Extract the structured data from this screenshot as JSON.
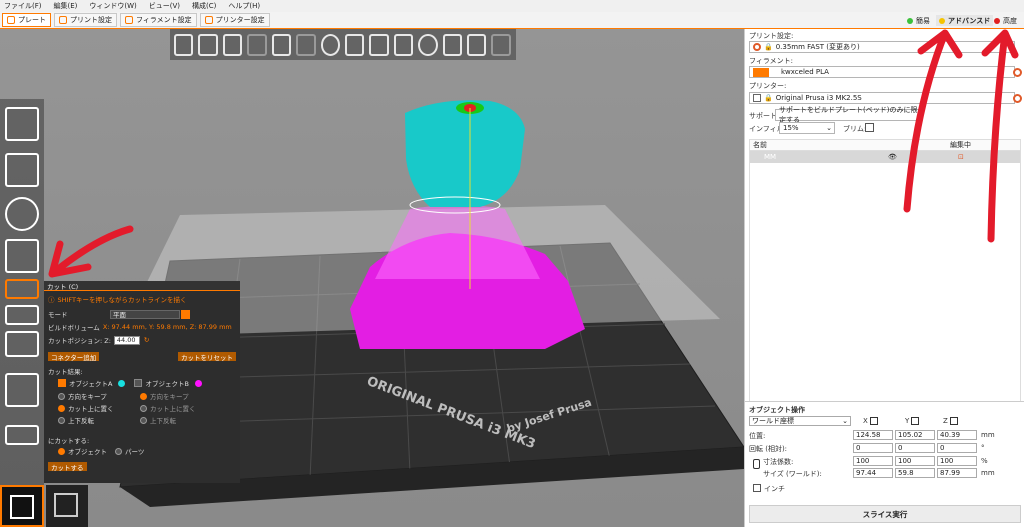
{
  "menu": [
    "ファイル(F)",
    "編集(E)",
    "ウィンドウ(W)",
    "ビュー(V)",
    "構成(C)",
    "ヘルプ(H)"
  ],
  "tabs": [
    {
      "label": "プレート",
      "active": true
    },
    {
      "label": "プリント設定",
      "active": false
    },
    {
      "label": "フィラメント設定",
      "active": false
    },
    {
      "label": "プリンター設定",
      "active": false
    }
  ],
  "modes": [
    {
      "label": "簡易",
      "color": "#3cc13c"
    },
    {
      "label": "アドバンスド",
      "color": "#f5c400",
      "active": true
    },
    {
      "label": "高度",
      "color": "#e02020"
    }
  ],
  "right": {
    "print_settings_label": "プリント設定:",
    "print_settings_value": "0.35mm FAST (変更あり)",
    "filament_label": "フィラメント:",
    "filament_value": "kwxceled PLA",
    "filament_color": "#ff7a00",
    "printer_label": "プリンター:",
    "printer_value": "Original Prusa i3 MK2.5S",
    "support_label": "サポート:",
    "support_value": "サポートをビルドプレート(ベッド)のみに限定する",
    "infill_label": "インフィル:",
    "infill_value": "15%",
    "brim_label": "ブリム:",
    "col_name": "名前",
    "col_editing": "編集中",
    "object_name": "MM"
  },
  "object_ops": {
    "title": "オブジェクト操作",
    "coord_system": "ワールド座標",
    "axes": [
      "X",
      "Y",
      "Z"
    ],
    "position_label": "位置:",
    "position": [
      "124.58",
      "105.02",
      "40.39"
    ],
    "position_unit": "mm",
    "rotation_label": "回転 (相対):",
    "rotation": [
      "0",
      "0",
      "0"
    ],
    "rotation_unit": "°",
    "scale_label": "寸法係数:",
    "scale": [
      "100",
      "100",
      "100"
    ],
    "scale_unit": "%",
    "size_label": "サイズ (ワールド):",
    "size": [
      "97.44",
      "59.8",
      "87.99"
    ],
    "size_unit": "mm",
    "inch_label": "インチ",
    "slice_button": "スライス実行"
  },
  "cut": {
    "title": "カット (C)",
    "hint": "SHIFTキーを押しながらカットラインを描く",
    "mode_label": "モード",
    "mode_value": "平面",
    "build_volume_label": "ビルドボリューム",
    "build_volume_value": "X: 97.44 mm, Y: 59.8 mm, Z: 87.99 mm",
    "cut_position_label": "カットポジション: Z:",
    "cut_position_value": "44.00",
    "add_connector": "コネクター追加",
    "reset_cut": "カットをリセット",
    "result_label": "カット結果:",
    "object_a": "オブジェクトA",
    "object_b": "オブジェクトB",
    "a_color": "#18e0e0",
    "b_color": "#ff10ff",
    "keep_orientation": "方向をキープ",
    "place_on_cut": "カット上に置く",
    "flip": "上下反転",
    "cut_to_label": "にカットする:",
    "to_objects": "オブジェクト",
    "to_parts": "パーツ",
    "do_cut": "カットする"
  },
  "bed_text": [
    "ORIGINAL PRUSA i3 MK3",
    "by Josef Prusa"
  ]
}
